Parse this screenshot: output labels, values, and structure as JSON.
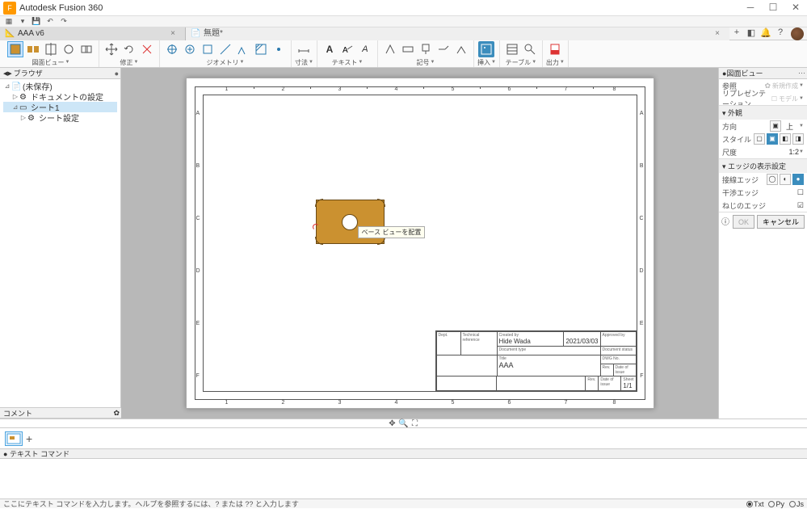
{
  "app": {
    "title": "Autodesk Fusion 360"
  },
  "tabs": [
    {
      "label": "AAA v6",
      "dirty": false
    },
    {
      "label": "無題*",
      "dirty": true
    }
  ],
  "toolbar_groups": {
    "view": "図面ビュー",
    "edit": "修正",
    "geometry": "ジオメトリ",
    "dim": "寸法",
    "text": "テキスト",
    "symbol": "記号",
    "insert": "挿入",
    "table": "テーブル",
    "output": "出力"
  },
  "browser": {
    "title": "ブラウザ",
    "root": "(未保存)",
    "doc_settings": "ドキュメントの設定",
    "sheet": "シート1",
    "sheet_settings": "シート設定"
  },
  "tooltip": "ベース ビューを配置",
  "title_block": {
    "dept_lbl": "Dept.",
    "techref_lbl": "Technical reference",
    "created_lbl": "Created by",
    "created_by": "Hide Wada",
    "created_date": "2021/03/03",
    "approved_lbl": "Approved by",
    "doctype_lbl": "Document type",
    "docstatus_lbl": "Document status",
    "title_lbl": "Title",
    "title": "AAA",
    "dwgno_lbl": "DWG No.",
    "rev_lbl": "Rev.",
    "date_issue_lbl": "Date of issue",
    "sheet_lbl": "Sheet",
    "sheet": "1/1"
  },
  "rulers": {
    "top": [
      "1",
      "2",
      "3",
      "4",
      "5",
      "6",
      "7",
      "8"
    ],
    "left": [
      "A",
      "B",
      "C",
      "D",
      "E",
      "F"
    ]
  },
  "right_panel": {
    "title": "図面ビュー",
    "ref_lbl": "参照",
    "newmake": "新規作成",
    "rep_lbl": "リプレゼンテーション",
    "model": "モデル",
    "appearance": "外観",
    "orientation_lbl": "方向",
    "orientation_val": "上",
    "style_lbl": "スタイル",
    "scale_lbl": "尺度",
    "scale_val": "1:2",
    "edge_title": "エッジの表示設定",
    "tangent_lbl": "接線エッジ",
    "interfere_lbl": "干渉エッジ",
    "thread_lbl": "ねじのエッジ",
    "ok": "OK",
    "cancel": "キャンセル"
  },
  "comment_panel": "コメント",
  "cmd_hint_label": "テキスト コマンド",
  "status_hint": "ここにテキスト コマンドを入力します。ヘルプを参照するには、? または ?? と入力します",
  "status_modes": [
    "Txt",
    "Py",
    "Js"
  ]
}
